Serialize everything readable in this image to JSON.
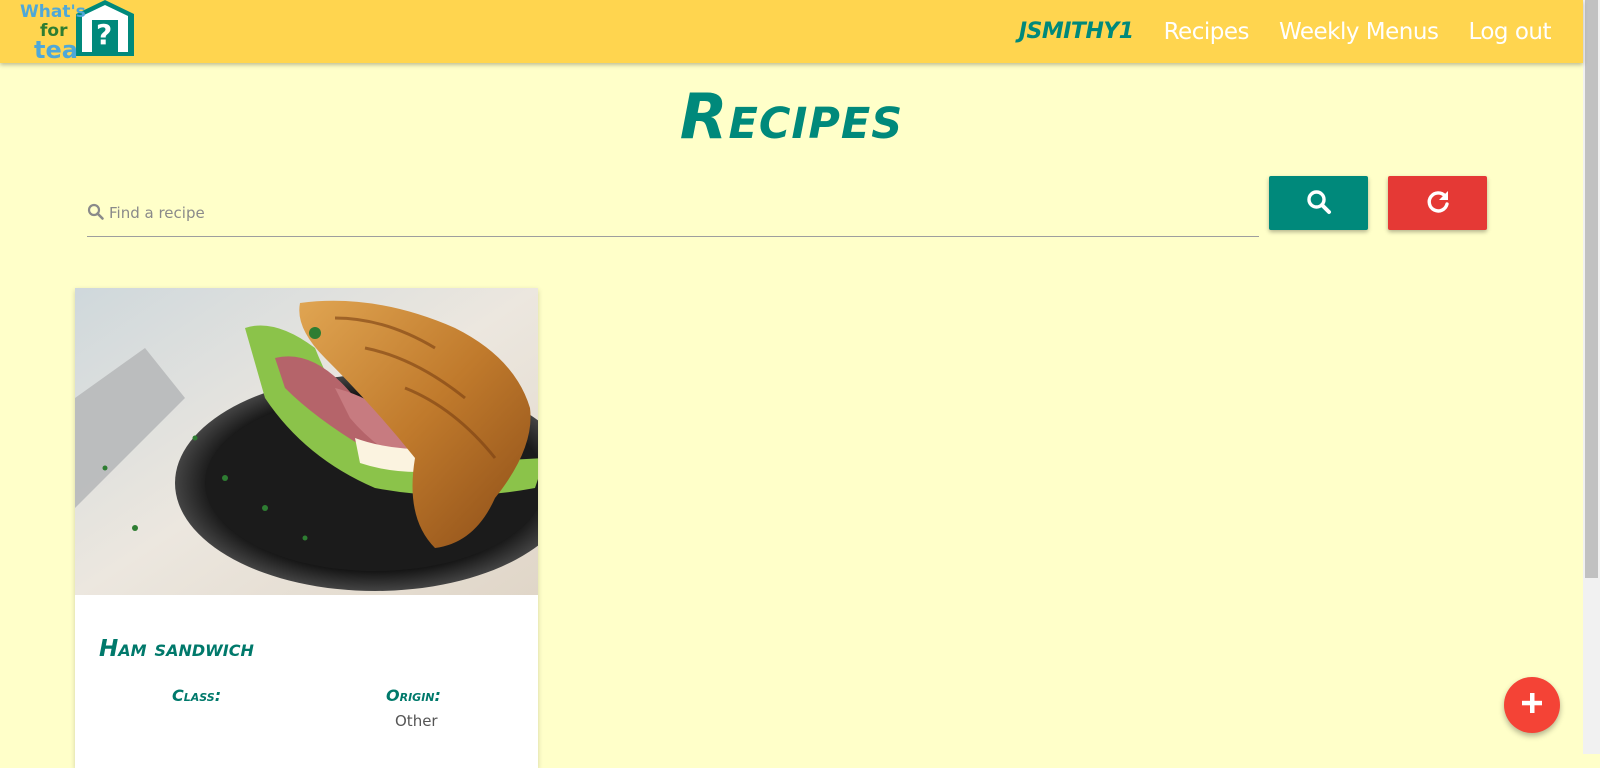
{
  "nav": {
    "logo_text": "What's for tea?",
    "user": "JSMITHY1",
    "links": [
      "Recipes",
      "Weekly Menus",
      "Log out"
    ]
  },
  "page": {
    "title": "Recipes"
  },
  "search": {
    "placeholder": "Find a recipe",
    "value": "",
    "search_icon": "search-icon",
    "reset_icon": "refresh-icon"
  },
  "recipes": [
    {
      "title": "Ham sandwich",
      "class_label": "Class:",
      "class_value": "",
      "origin_label": "Origin:",
      "origin_value": "Other"
    }
  ],
  "fab": {
    "icon": "plus-icon"
  },
  "colors": {
    "header": "#ffd54f",
    "background": "#ffffc9",
    "teal": "#00897b",
    "red": "#e53935",
    "fab": "#f44336"
  }
}
